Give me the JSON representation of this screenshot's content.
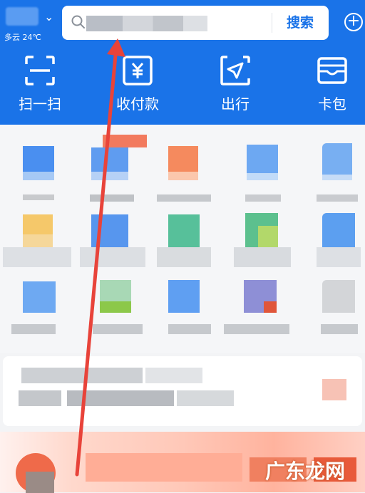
{
  "header": {
    "weather": {
      "condition": "多云 24℃"
    },
    "search": {
      "button_label": "搜索"
    },
    "quick_actions": [
      {
        "label": "扫一扫",
        "icon": "scan-icon"
      },
      {
        "label": "收付款",
        "icon": "yuan-payment-icon"
      },
      {
        "label": "出行",
        "icon": "navigation-arrow-icon"
      },
      {
        "label": "卡包",
        "icon": "wallet-icon"
      }
    ]
  },
  "watermark": {
    "text": "广东龙网",
    "sub": "http://..."
  },
  "colors": {
    "brand_blue": "#1a73e8",
    "annotation_red": "#e8433a"
  }
}
